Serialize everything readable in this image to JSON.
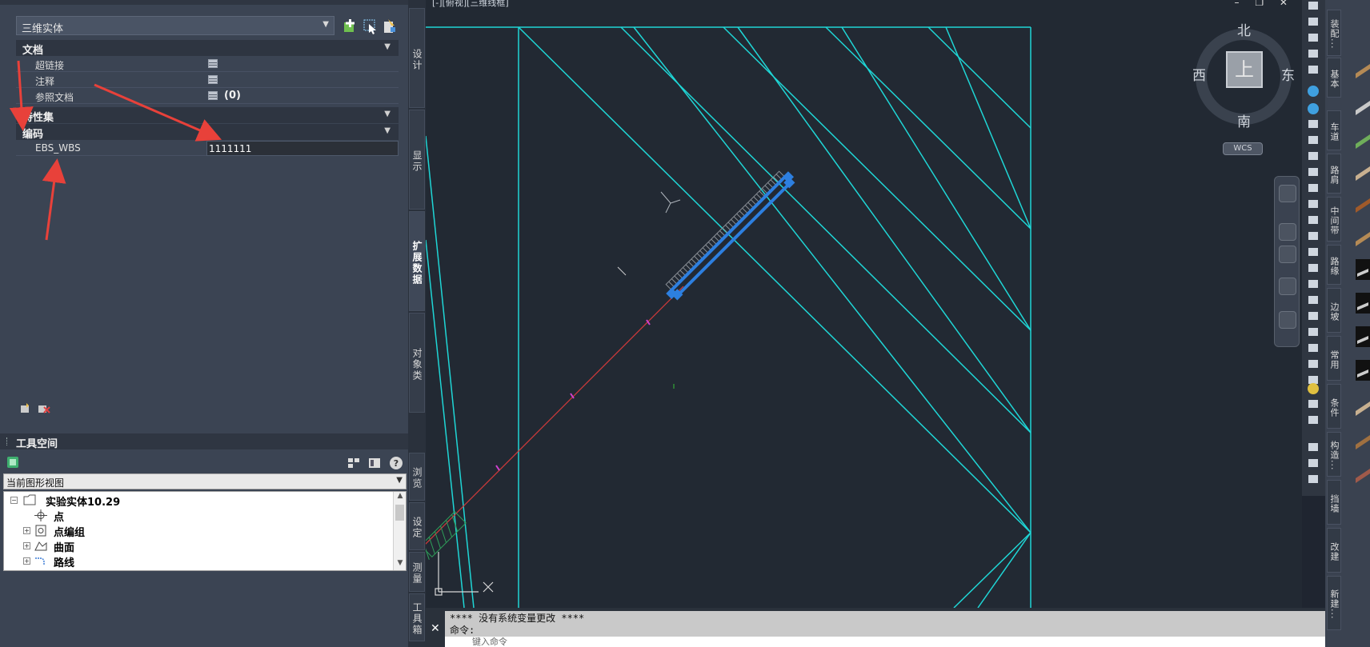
{
  "viewport": {
    "label": "[-][俯视][三维线框]",
    "window_buttons": "– ❐ ✕"
  },
  "properties": {
    "object_type": "三维实体",
    "sections": {
      "document": "文档",
      "property_set": "特性集",
      "code": "编码"
    },
    "rows": [
      {
        "key": "超链接",
        "value": ""
      },
      {
        "key": "注释",
        "value": ""
      },
      {
        "key": "参照文档",
        "value": "(0)"
      }
    ],
    "ebs_key": "EBS_WBS",
    "ebs_value": "1111111"
  },
  "vertical_tabs": [
    "设计",
    "显示",
    "扩展数据",
    "对象类",
    "浏览",
    "设定",
    "测量",
    "工具箱"
  ],
  "toolspace": {
    "title": "工具空间",
    "view_select": "当前图形视图",
    "tree": [
      {
        "label": "实验实体10.29",
        "level": 0,
        "expander": "−"
      },
      {
        "label": "点",
        "level": 1,
        "expander": ""
      },
      {
        "label": "点编组",
        "level": 1,
        "expander": "+"
      },
      {
        "label": "曲面",
        "level": 1,
        "expander": "+"
      },
      {
        "label": "路线",
        "level": 1,
        "expander": "+"
      }
    ]
  },
  "viewcube": {
    "top": "上",
    "north": "北",
    "south": "南",
    "east": "东",
    "west": "西",
    "wcs": "WCS"
  },
  "command": {
    "history_1": "**** 没有系统变量更改 ****",
    "history_2": "命令:",
    "prompt": "键入命令"
  },
  "right_palette_tabs": [
    "装配...",
    "基本",
    "车道",
    "路肩",
    "中间带",
    "路缘",
    "边坡",
    "常用",
    "条件",
    "构造...",
    "挡墙",
    "改建",
    "新建..."
  ],
  "colors": {
    "model_line": "#1fd6d6",
    "selection": "#2d7fe0",
    "leader": "#d23b3b",
    "annotation_arrow": "#e8413a"
  }
}
